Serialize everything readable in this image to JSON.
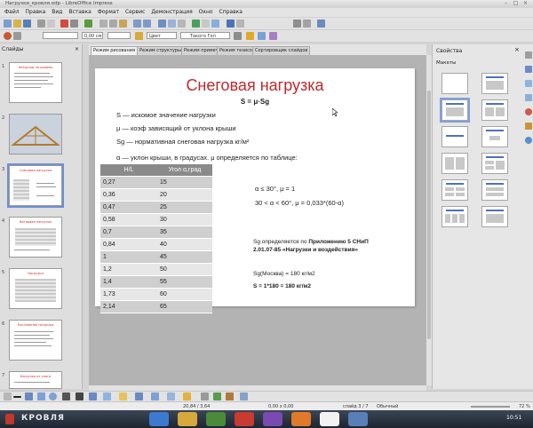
{
  "window": {
    "title": "Нагрузки_кровля.odp - LibreOffice Impress"
  },
  "menu": [
    "Файл",
    "Правка",
    "Вид",
    "Вставка",
    "Формат",
    "Сервис",
    "Демонстрация",
    "Окно",
    "Справка"
  ],
  "toolbar2": {
    "line_width": "0,00 см",
    "color_name": "Цвет",
    "shadow_color": "Такого Гол"
  },
  "slides_panel": {
    "header": "Слайды",
    "thumbs": [
      {
        "num": "1",
        "title": "Нагрузки на кровлю"
      },
      {
        "num": "2",
        "title": ""
      },
      {
        "num": "3",
        "title": "Снеговая нагрузка"
      },
      {
        "num": "4",
        "title": "Ветровая нагрузка"
      },
      {
        "num": "5",
        "title": "Нагрузки"
      },
      {
        "num": "6",
        "title": "Постоянная нагрузка"
      },
      {
        "num": "7",
        "title": "Нагрузка от снега"
      }
    ]
  },
  "tabs": [
    "Режим рисования",
    "Режим структуры",
    "Режим примечаний",
    "Режим тезисов",
    "Сортировщик слайдов"
  ],
  "slide": {
    "title": "Снеговая нагрузка",
    "formula": "S = μ·Sg",
    "lines": [
      "S — искомое значение нагрузки",
      "μ — коэф зависящий от уклона крыши",
      "Sg — нормативная снеговая нагрузка кг/м²",
      "α — уклон крыши, в градусах.  μ определяется по таблице:"
    ],
    "table": {
      "headers": [
        "Н/L",
        "Угол α,град"
      ],
      "rows": [
        [
          "0,27",
          "15"
        ],
        [
          "0,36",
          "20"
        ],
        [
          "0,47",
          "25"
        ],
        [
          "0,58",
          "30"
        ],
        [
          "0,7",
          "35"
        ],
        [
          "0,84",
          "40"
        ],
        [
          "1",
          "45"
        ],
        [
          "1,2",
          "50"
        ],
        [
          "1,4",
          "55"
        ],
        [
          "1,73",
          "60"
        ],
        [
          "2,14",
          "65"
        ]
      ]
    },
    "cond1": "α ≤ 30°,  μ = 1",
    "cond2": "30 < α < 60°,  μ = 0,033*(60-α)",
    "note_prefix": "Sg определяется по ",
    "note_bold": "Приложению 5 СНиП 2.01.07-85 «Нагрузки и воздействия»",
    "sg": "Sg(Москва) = 180 кг/м2",
    "result": "S = 1*180 = 180 кг/м2"
  },
  "props": {
    "header": "Свойства",
    "section": "Макеты"
  },
  "statusbar": {
    "position": "20,84 / 3,64",
    "size": "0,00 x 0,00",
    "slide": "слайд 3 / 7",
    "layout": "Обычный",
    "zoom": "72 %"
  },
  "watermark": "КРОВЛЯ",
  "clock": "10:51"
}
